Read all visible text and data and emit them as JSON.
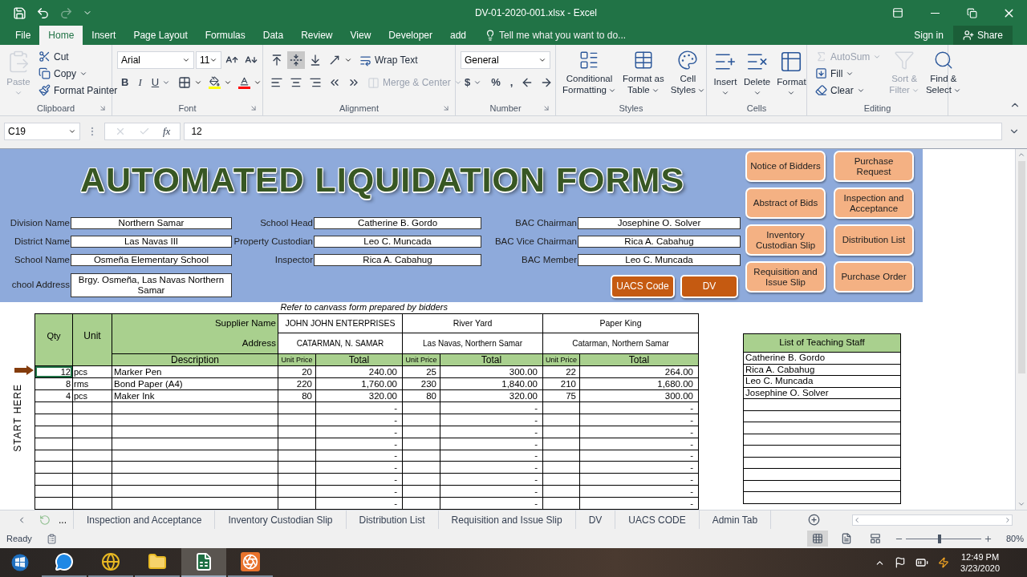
{
  "window": {
    "title": "DV-01-2020-001.xlsx - Excel"
  },
  "quick_access": [
    {
      "disabled": false
    },
    {
      "disabled": false
    },
    {
      "disabled": true
    },
    {
      "disabled": false
    }
  ],
  "ribbon_tabs": [
    {
      "label": "File",
      "selected": false
    },
    {
      "label": "Home",
      "selected": true
    },
    {
      "label": "Insert",
      "selected": false
    },
    {
      "label": "Page Layout",
      "selected": false
    },
    {
      "label": "Formulas",
      "selected": false
    },
    {
      "label": "Data",
      "selected": false
    },
    {
      "label": "Review",
      "selected": false
    },
    {
      "label": "View",
      "selected": false
    },
    {
      "label": "Developer",
      "selected": false
    },
    {
      "label": "add",
      "selected": false
    }
  ],
  "tell_me": {
    "placeholder": "Tell me what you want to do..."
  },
  "account": {
    "sign_in": "Sign in",
    "share": "Share"
  },
  "ribbon": {
    "groups": [
      {
        "label": "Clipboard",
        "launcher": true,
        "kind": "columns",
        "lines": [
          [
            {
              "kind": "tall",
              "label": "Paste",
              "menu": true,
              "disabled": true
            }
          ],
          [
            {
              "kind": "small",
              "label": "Cut",
              "disabled": false
            },
            {
              "kind": "small",
              "label": "Copy",
              "menu": true,
              "disabled": false
            },
            {
              "kind": "small",
              "label": "Format Painter",
              "disabled": false
            }
          ]
        ]
      },
      {
        "label": "Font",
        "launcher": true,
        "kind": "rows",
        "lines": [
          [
            {
              "kind": "field",
              "value": "Arial"
            },
            {
              "kind": "field",
              "value": "11"
            },
            {
              "kind": "icon"
            },
            {
              "kind": "icon"
            }
          ],
          [
            {
              "kind": "bold",
              "label": "B"
            },
            {
              "kind": "italic",
              "label": "I"
            },
            {
              "kind": "underline",
              "label": "U",
              "menu": true
            },
            {
              "kind": "icon",
              "menu": true
            },
            {
              "kind": "icon",
              "menu": true
            },
            {
              "kind": "icon",
              "menu": true
            }
          ]
        ]
      },
      {
        "label": "Alignment",
        "launcher": true,
        "kind": "rows",
        "lines": [
          [
            {
              "kind": "icon",
              "on": false,
              "disabled": false
            },
            {
              "kind": "icon",
              "on": true,
              "disabled": false
            },
            {
              "kind": "icon",
              "on": false,
              "disabled": false
            },
            {
              "kind": "icon",
              "menu": true,
              "on": false,
              "disabled": false
            },
            {
              "kind": "small",
              "label": "Wrap Text",
              "on": false,
              "disabled": false
            }
          ],
          [
            {
              "kind": "icon",
              "on": false,
              "disabled": false
            },
            {
              "kind": "icon",
              "on": false,
              "disabled": false
            },
            {
              "kind": "icon",
              "on": false,
              "disabled": false
            },
            {
              "kind": "icon",
              "on": false,
              "disabled": false
            },
            {
              "kind": "icon",
              "on": false,
              "disabled": false
            },
            {
              "kind": "small",
              "label": "Merge & Center",
              "menu": true,
              "on": false,
              "disabled": true
            }
          ]
        ]
      },
      {
        "label": "Number",
        "launcher": true,
        "kind": "rows",
        "lines": [
          [
            {
              "kind": "field",
              "value": "General"
            }
          ],
          [
            {
              "kind": "text",
              "label": "$",
              "menu": true
            },
            {
              "kind": "text",
              "label": "%"
            },
            {
              "kind": "text",
              "label": ","
            },
            {
              "kind": "icon"
            },
            {
              "kind": "icon"
            }
          ]
        ]
      },
      {
        "label": "Styles",
        "kind": "columns",
        "lines": [
          [
            {
              "kind": "large",
              "label": "Conditional\nFormatting",
              "menu": true
            }
          ],
          [
            {
              "kind": "large",
              "label": "Format as\nTable",
              "menu": true
            }
          ],
          [
            {
              "kind": "large",
              "label": "Cell\nStyles",
              "menu": true
            }
          ]
        ]
      },
      {
        "label": "Cells",
        "kind": "columns",
        "lines": [
          [
            {
              "kind": "tall",
              "label": "Insert",
              "menu": true
            }
          ],
          [
            {
              "kind": "tall",
              "label": "Delete",
              "menu": true
            }
          ],
          [
            {
              "kind": "tall",
              "label": "Format",
              "menu": true
            }
          ]
        ]
      },
      {
        "label": "Editing",
        "kind": "columns",
        "lines": [
          [
            {
              "kind": "small",
              "label": "AutoSum",
              "menu": true,
              "disabled": true
            },
            {
              "kind": "small",
              "label": "Fill",
              "menu": true,
              "disabled": false
            },
            {
              "kind": "small",
              "label": "Clear",
              "menu": true,
              "disabled": false
            }
          ],
          [
            {
              "kind": "large",
              "label": "Sort &\nFilter",
              "menu": true,
              "disabled": true
            }
          ],
          [
            {
              "kind": "large",
              "label": "Find &\nSelect",
              "menu": true,
              "disabled": false
            }
          ]
        ]
      }
    ]
  },
  "formula_bar": {
    "name_box": "C19",
    "function_label": "fx",
    "value": "12"
  },
  "banner": {
    "title": "AUTOMATED LIQUIDATION FORMS",
    "field_columns": [
      [
        {
          "label": "Division Name",
          "value": "Northern Samar"
        },
        {
          "label": "District Name",
          "value": "Las Navas III"
        },
        {
          "label": "School Name",
          "value": "Osmeña Elementary School"
        },
        {
          "label": "chool Address",
          "value": "Brgy. Osmeña, Las Navas Northern Samar"
        }
      ],
      [
        {
          "label": "School Head",
          "value": "Catherine B. Gordo"
        },
        {
          "label": "Property Custodian",
          "value": "Leo C. Muncada"
        },
        {
          "label": "Inspector",
          "value": "Rica A. Cabahug"
        }
      ],
      [
        {
          "label": "BAC Chairman",
          "value": "Josephine O. Solver"
        },
        {
          "label": "BAC Vice Chairman",
          "value": "Rica A. Cabahug"
        },
        {
          "label": "BAC Member",
          "value": "Leo C. Muncada"
        }
      ]
    ],
    "action_buttons": [
      {
        "label": "UACS Code"
      },
      {
        "label": "DV"
      }
    ],
    "nav_buttons": [
      {
        "label": "Notice of Bidders"
      },
      {
        "label": "Purchase Request"
      },
      {
        "label": "Abstract of Bids"
      },
      {
        "label": "Inspection and Acceptance"
      },
      {
        "label": "Inventory Custodian Slip"
      },
      {
        "label": "Distribution List"
      },
      {
        "label": "Requisition  and Issue Slip"
      },
      {
        "label": "Purchase Order"
      }
    ]
  },
  "start_marker": {
    "label": "START HERE"
  },
  "canvass": {
    "note": "Refer to canvass form prepared by bidders",
    "headers": {
      "qty": "Qty",
      "unit": "Unit",
      "supplier_name": "Supplier Name",
      "address": "Address",
      "description": "Description"
    },
    "suppliers": [
      {
        "name": "JOHN JOHN ENTERPRISES",
        "address": "CATARMAN, N. SAMAR",
        "unit_price": "Unit Price",
        "total": "Total"
      },
      {
        "name": "River Yard",
        "address": "Las Navas, Northern Samar",
        "unit_price": "Unit Price",
        "total": "Total"
      },
      {
        "name": "Paper King",
        "address": "Catarman, Northern Samar",
        "unit_price": "Unit Price",
        "total": "Total"
      }
    ],
    "rows": [
      {
        "selected": true,
        "qty": "12",
        "unit": "pcs",
        "description": "Marker Pen",
        "bids": [
          {
            "unit_price": "20",
            "total": "240.00"
          },
          {
            "unit_price": "25",
            "total": "300.00"
          },
          {
            "unit_price": "22",
            "total": "264.00"
          }
        ]
      },
      {
        "selected": false,
        "qty": "8",
        "unit": "rms",
        "description": "Bond Paper (A4)",
        "bids": [
          {
            "unit_price": "220",
            "total": "1,760.00"
          },
          {
            "unit_price": "230",
            "total": "1,840.00"
          },
          {
            "unit_price": "210",
            "total": "1,680.00"
          }
        ]
      },
      {
        "selected": false,
        "qty": "4",
        "unit": "pcs",
        "description": "Maker Ink",
        "bids": [
          {
            "unit_price": "80",
            "total": "320.00"
          },
          {
            "unit_price": "80",
            "total": "320.00"
          },
          {
            "unit_price": "75",
            "total": "300.00"
          }
        ]
      },
      {
        "selected": false,
        "bids": [
          {
            "total": "-"
          },
          {
            "total": "-"
          },
          {
            "total": "-"
          }
        ]
      },
      {
        "selected": false,
        "bids": [
          {
            "total": "-"
          },
          {
            "total": "-"
          },
          {
            "total": "-"
          }
        ]
      },
      {
        "selected": false,
        "bids": [
          {
            "total": "-"
          },
          {
            "total": "-"
          },
          {
            "total": "-"
          }
        ]
      },
      {
        "selected": false,
        "bids": [
          {
            "total": "-"
          },
          {
            "total": "-"
          },
          {
            "total": "-"
          }
        ]
      },
      {
        "selected": false,
        "bids": [
          {
            "total": "-"
          },
          {
            "total": "-"
          },
          {
            "total": "-"
          }
        ]
      },
      {
        "selected": false,
        "bids": [
          {
            "total": "-"
          },
          {
            "total": "-"
          },
          {
            "total": "-"
          }
        ]
      },
      {
        "selected": false,
        "bids": [
          {
            "total": "-"
          },
          {
            "total": "-"
          },
          {
            "total": "-"
          }
        ]
      },
      {
        "selected": false,
        "bids": [
          {
            "total": "-"
          },
          {
            "total": "-"
          },
          {
            "total": "-"
          }
        ]
      },
      {
        "selected": false,
        "bids": [
          {
            "total": "-"
          },
          {
            "total": "-"
          },
          {
            "total": "-"
          }
        ]
      }
    ]
  },
  "staff": {
    "title": "List of Teaching Staff",
    "names": [
      "Catherine B. Gordo",
      "Rica A. Cabahug",
      "Leo C. Muncada",
      "Josephine O. Solver"
    ]
  },
  "sheet_tabs": {
    "more": "...",
    "items": [
      {
        "label": "Inspection and Acceptance"
      },
      {
        "label": "Inventory Custodian Slip"
      },
      {
        "label": "Distribution List"
      },
      {
        "label": "Requisition and Issue Slip"
      },
      {
        "label": "DV"
      },
      {
        "label": "UACS CODE"
      },
      {
        "label": "Admin Tab"
      }
    ]
  },
  "status_bar": {
    "status": "Ready",
    "views": [
      {
        "selected": true
      },
      {
        "selected": false
      },
      {
        "selected": false
      }
    ],
    "zoom": {
      "label": "80%",
      "level": 0.45
    }
  },
  "taskbar": {
    "apps": [
      {
        "selected": false
      },
      {
        "selected": false
      },
      {
        "selected": false
      },
      {
        "selected": true
      },
      {
        "selected": false
      }
    ],
    "time": "12:49 PM",
    "date": "3/23/2020"
  }
}
